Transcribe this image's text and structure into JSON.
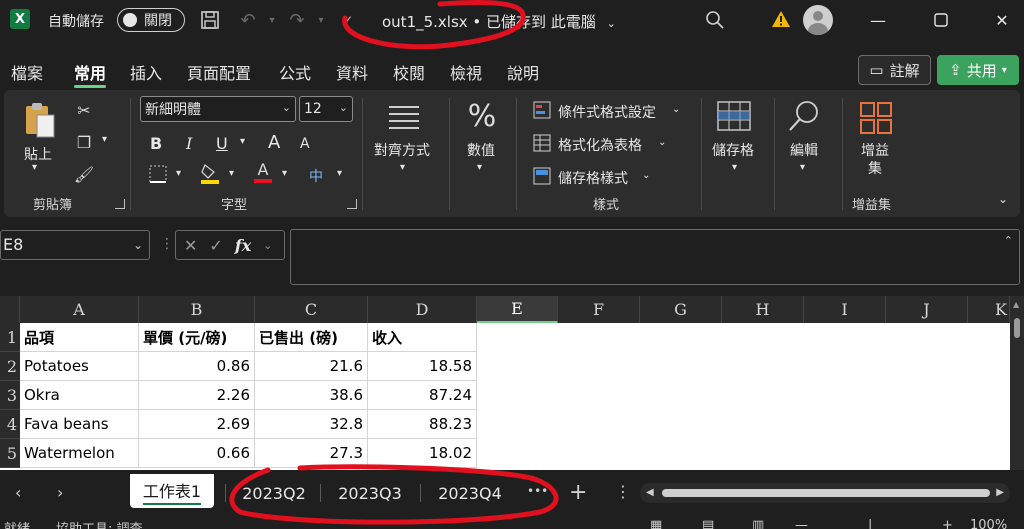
{
  "titlebar": {
    "app_icon_letter": "X",
    "autosave_label": "自動儲存",
    "autosave_state": "關閉",
    "document_title": "out1_5.xlsx • 已儲存到 此電腦",
    "icons": [
      "excel-icon",
      "save-icon",
      "undo-icon",
      "redo-icon",
      "customize-icon",
      "search-icon",
      "warning-icon",
      "avatar",
      "minimize-icon",
      "maximize-icon",
      "close-icon"
    ]
  },
  "menu": {
    "tabs": [
      "檔案",
      "常用",
      "插入",
      "頁面配置",
      "公式",
      "資料",
      "校閱",
      "檢視",
      "說明"
    ],
    "active": "常用",
    "comment_label": "註解",
    "share_label": "共用"
  },
  "ribbon": {
    "clipboard": {
      "paste": "貼上",
      "group": "剪貼簿"
    },
    "font": {
      "name": "新細明體",
      "size": "12",
      "bold": "B",
      "italic": "I",
      "underline": "U",
      "grow": "A",
      "shrink": "A",
      "font_color_letter": "A",
      "phonetic": "中",
      "group": "字型"
    },
    "alignment": {
      "label": "對齊方式"
    },
    "number": {
      "label": "數值"
    },
    "styles": {
      "conditional": "條件式格式設定",
      "table": "格式化為表格",
      "cell_styles": "儲存格樣式",
      "group": "樣式"
    },
    "cells": {
      "label": "儲存格"
    },
    "editing": {
      "label": "編輯"
    },
    "addins": {
      "label": "增益集",
      "group": "增益集"
    },
    "accent_highlight": "#ffd800",
    "accent_fontcolor": "#e81123"
  },
  "formula_bar": {
    "name_box": "E8",
    "fx": "fx",
    "content": ""
  },
  "sheet": {
    "columns": [
      "A",
      "B",
      "C",
      "D",
      "E",
      "F",
      "G",
      "H",
      "I",
      "J",
      "K"
    ],
    "selected_column": "E",
    "rows": [
      {
        "num": "1",
        "cells": [
          "品項",
          "單價 (元/磅)",
          "已售出 (磅)",
          "收入"
        ]
      },
      {
        "num": "2",
        "cells": [
          "Potatoes",
          "0.86",
          "21.6",
          "18.58"
        ]
      },
      {
        "num": "3",
        "cells": [
          "Okra",
          "2.26",
          "38.6",
          "87.24"
        ]
      },
      {
        "num": "4",
        "cells": [
          "Fava beans",
          "2.69",
          "32.8",
          "88.23"
        ]
      },
      {
        "num": "5",
        "cells": [
          "Watermelon",
          "0.66",
          "27.3",
          "18.02"
        ]
      }
    ]
  },
  "sheet_tabs": {
    "tabs": [
      "工作表1",
      "2023Q2",
      "2023Q3",
      "2023Q4"
    ],
    "active": "工作表1",
    "more": "•••",
    "add": "+"
  },
  "status": {
    "ready": "就緒",
    "accessibility": "協助工具: 調查",
    "zoom": "100%"
  },
  "annotation_color": "#e0101e"
}
